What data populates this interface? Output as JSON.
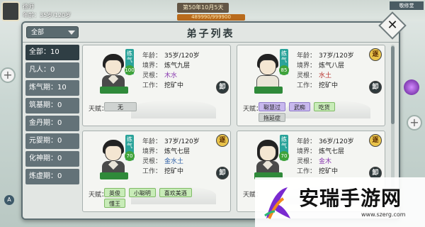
{
  "hud": {
    "player_label": "徐师",
    "age_text": "年龄：35岁/120岁",
    "date_text": "第50年10月5天",
    "gold_text": "489990/999900",
    "settings_text": "敬修堂"
  },
  "panel": {
    "title": "弟子列表",
    "filter_value": "全部",
    "close_symbol": "✕"
  },
  "sidebar": {
    "tabs": [
      {
        "label": "全部：10",
        "active": true
      },
      {
        "label": "凡人：0"
      },
      {
        "label": "炼气期：10"
      },
      {
        "label": "筑基期：0"
      },
      {
        "label": "金丹期：0"
      },
      {
        "label": "元婴期：0"
      },
      {
        "label": "化神期：0"
      },
      {
        "label": "炼虚期：0"
      }
    ]
  },
  "labels": {
    "age": "年龄：",
    "realm": "境界：",
    "root": "灵根：",
    "job": "工作：",
    "talent": "天赋："
  },
  "disciples": [
    {
      "age": "35岁/120岁",
      "realm": "炼气九层",
      "root": "木水",
      "job": "挖矿中",
      "realm_badge": "练气",
      "level": "100",
      "talents": [
        {
          "text": "无",
          "tone": "gray"
        }
      ],
      "actions": [
        "卸"
      ]
    },
    {
      "age": "37岁/120岁",
      "realm": "炼气八层",
      "root": "水土",
      "job": "挖矿中",
      "realm_badge": "练气",
      "level": "85",
      "talents": [
        {
          "text": "聪慧过",
          "tone": "purple"
        },
        {
          "text": "武痴",
          "tone": "purple"
        },
        {
          "text": "吃货",
          "tone": "green"
        },
        {
          "text": "拖延症",
          "tone": "gray"
        }
      ],
      "actions": [
        "逐",
        "卸"
      ]
    },
    {
      "age": "37岁/120岁",
      "realm": "炼气七层",
      "root": "金水土",
      "job": "挖矿中",
      "realm_badge": "练气",
      "level": "70",
      "talents": [
        {
          "text": "英俊",
          "tone": "green"
        },
        {
          "text": "小聪明",
          "tone": "green"
        },
        {
          "text": "喜欢美酒",
          "tone": "green"
        },
        {
          "text": "懂王",
          "tone": "green"
        }
      ],
      "actions": [
        "逐",
        "卸"
      ]
    },
    {
      "age": "36岁/120岁",
      "realm": "炼气七层",
      "root": "金木",
      "job": "挖矿中",
      "realm_badge": "练气",
      "level": "70",
      "talents": [],
      "actions": [
        "逐",
        "卸"
      ]
    }
  ],
  "watermark": {
    "title": "安瑞手游网",
    "url": "www.szerg.com"
  },
  "colors": {
    "panel_border": "#5e6f73",
    "tab_active": "#2f3e44",
    "tab_normal": "#637278",
    "badge_teal": "#2aa39a"
  }
}
